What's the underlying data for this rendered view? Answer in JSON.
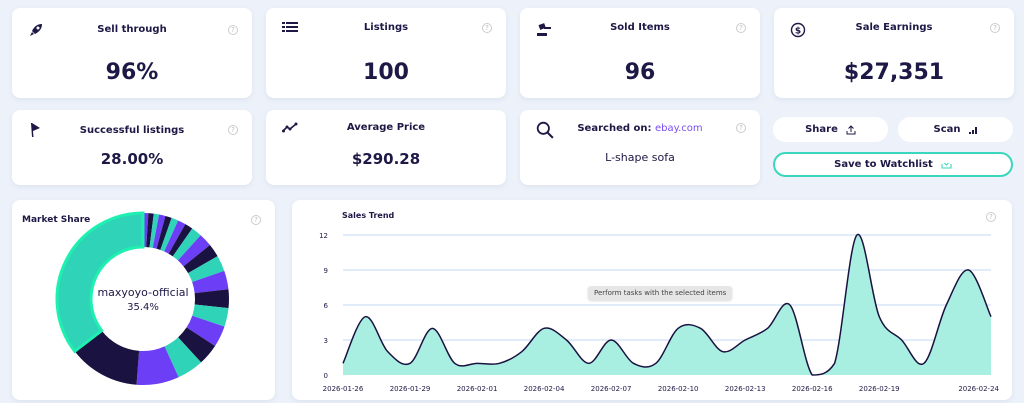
{
  "stats": [
    {
      "title": "Sell through",
      "value": "96%",
      "icon": "rocket-icon"
    },
    {
      "title": "Listings",
      "value": "100",
      "icon": "list-icon"
    },
    {
      "title": "Sold Items",
      "value": "96",
      "icon": "gavel-icon"
    },
    {
      "title": "Sale Earnings",
      "value": "$27,351",
      "icon": "dollar-circle-icon"
    },
    {
      "title": "Successful listings",
      "value": "28.00%",
      "icon": "flag-icon"
    },
    {
      "title": "Average Price",
      "value": "$290.28",
      "icon": "trend-icon"
    }
  ],
  "search": {
    "label": "Searched on:",
    "site": "ebay.com",
    "query": "L-shape sofa",
    "icon": "search-icon"
  },
  "actions": {
    "share": "Share",
    "scan": "Scan",
    "save": "Save to Watchlist"
  },
  "help_glyph": "?",
  "colors": {
    "dark": "#1a1240",
    "purple": "#6c3ef5",
    "teal": "#2fd3b8",
    "highlight": "#1ef0b0",
    "area": "#a8efe2"
  },
  "chart_data": [
    {
      "type": "pie",
      "title": "Market Share",
      "center_label": "maxyoyo-official",
      "center_value": "35.4%",
      "values": [
        1.0,
        1.0,
        1.0,
        1.2,
        1.2,
        1.3,
        1.5,
        1.5,
        2.0,
        2.5,
        2.5,
        3.0,
        3.5,
        3.5,
        3.5,
        4.0,
        4.0,
        5.0,
        8.0,
        13.4,
        35.4
      ],
      "highlighted": "maxyoyo-official"
    },
    {
      "type": "area",
      "title": "Sales Trend",
      "ylim": [
        0,
        12
      ],
      "yticks": [
        0,
        3,
        6,
        9,
        12
      ],
      "grid": true,
      "x": [
        "2026-01-26",
        "2026-01-27",
        "2026-01-28",
        "2026-01-29",
        "2026-01-30",
        "2026-01-31",
        "2026-02-01",
        "2026-02-02",
        "2026-02-03",
        "2026-02-04",
        "2026-02-05",
        "2026-02-06",
        "2026-02-07",
        "2026-02-08",
        "2026-02-09",
        "2026-02-10",
        "2026-02-11",
        "2026-02-12",
        "2026-02-13",
        "2026-02-14",
        "2026-02-15",
        "2026-02-16",
        "2026-02-17",
        "2026-02-18",
        "2026-02-19",
        "2026-02-20",
        "2026-02-21",
        "2026-02-22",
        "2026-02-23",
        "2026-02-24"
      ],
      "xticks": [
        "2026-01-26",
        "2026-01-29",
        "2026-02-01",
        "2026-02-04",
        "2026-02-07",
        "2026-02-10",
        "2026-02-13",
        "2026-02-16",
        "2026-02-19",
        "2026-02-24"
      ],
      "values": [
        1,
        5,
        2,
        1,
        4,
        1,
        1,
        1,
        2,
        4,
        3,
        1,
        3,
        1,
        1,
        4,
        4,
        2,
        3,
        4,
        6,
        0,
        1,
        12,
        5,
        3,
        1,
        6,
        9,
        5
      ]
    }
  ],
  "tooltip": "Perform tasks with the selected items"
}
